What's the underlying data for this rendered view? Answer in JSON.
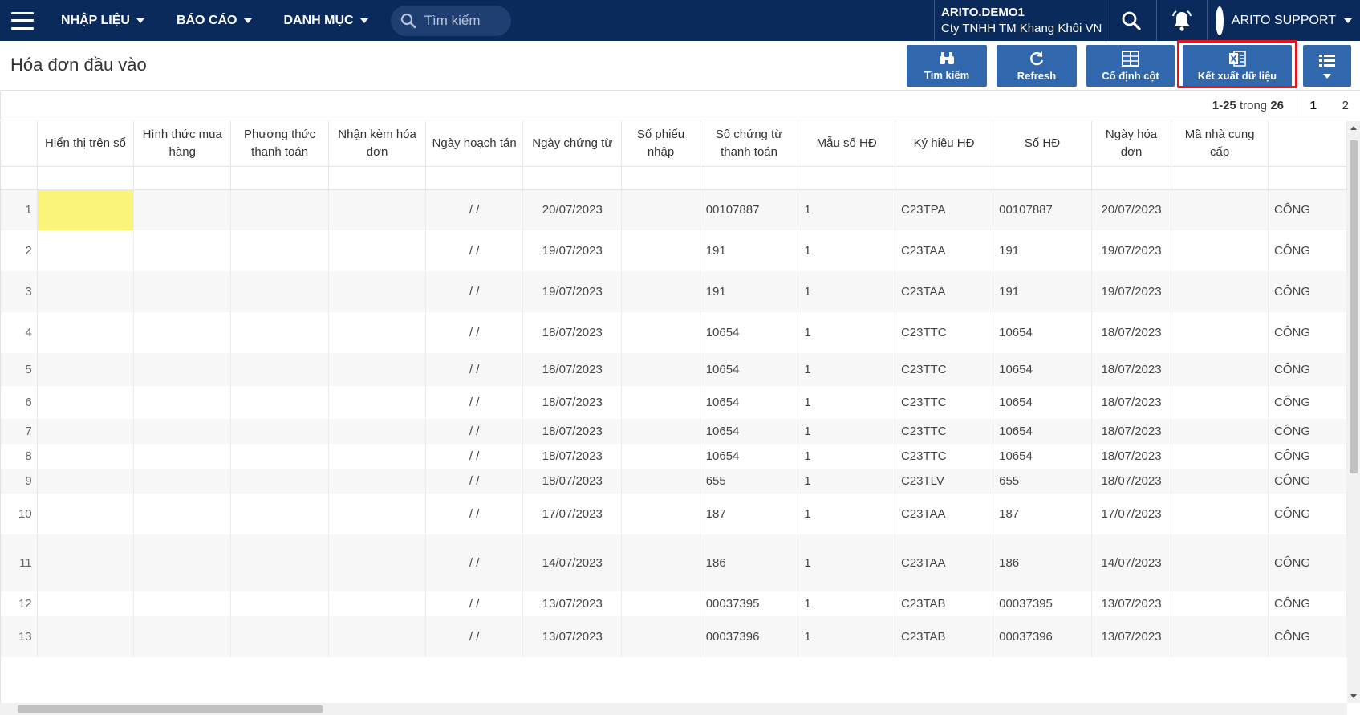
{
  "nav": {
    "menu": [
      {
        "label": "NHẬP LIỆU"
      },
      {
        "label": "BÁO CÁO"
      },
      {
        "label": "DANH MỤC"
      }
    ],
    "search_placeholder": "Tìm kiếm",
    "company_code": "ARITO.DEMO1",
    "company_name": "Cty TNHH TM Khang Khôi VN",
    "user_name": "ARITO SUPPORT"
  },
  "page": {
    "title": "Hóa đơn đầu vào"
  },
  "toolbar": {
    "search_label": "Tìm kiếm",
    "refresh_label": "Refresh",
    "freeze_label": "Cố định cột",
    "export_label": "Kết xuất dữ liệu"
  },
  "pager": {
    "range": "1-25",
    "of_word": "trong",
    "total": "26",
    "pages": [
      "1",
      "2"
    ],
    "current_page": "1"
  },
  "grid": {
    "columns": [
      "Hiển thị trên sổ",
      "Hình thức mua hàng",
      "Phương thức thanh toán",
      "Nhận kèm hóa đơn",
      "Ngày hoạch tán",
      "Ngày chứng từ",
      "Số phiếu nhập",
      "Số chứng từ thanh toán",
      "Mẫu số HĐ",
      "Ký hiệu HĐ",
      "Số HĐ",
      "Ngày hóa đơn",
      "Mã nhà cung cấp",
      ""
    ],
    "rows": [
      {
        "no": "1",
        "hach_toan": "/ /",
        "ngay_ct": "20/07/2023",
        "so_ct_tt": "00107887",
        "mau_so": "1",
        "ky_hieu": "C23TPA",
        "so_hd": "00107887",
        "ngay_hd": "20/07/2023",
        "extra": "CÔNG"
      },
      {
        "no": "2",
        "hach_toan": "/ /",
        "ngay_ct": "19/07/2023",
        "so_ct_tt": "191",
        "mau_so": "1",
        "ky_hieu": "C23TAA",
        "so_hd": "191",
        "ngay_hd": "19/07/2023",
        "extra": "CÔNG"
      },
      {
        "no": "3",
        "hach_toan": "/ /",
        "ngay_ct": "19/07/2023",
        "so_ct_tt": "191",
        "mau_so": "1",
        "ky_hieu": "C23TAA",
        "so_hd": "191",
        "ngay_hd": "19/07/2023",
        "extra": "CÔNG"
      },
      {
        "no": "4",
        "hach_toan": "/ /",
        "ngay_ct": "18/07/2023",
        "so_ct_tt": "10654",
        "mau_so": "1",
        "ky_hieu": "C23TTC",
        "so_hd": "10654",
        "ngay_hd": "18/07/2023",
        "extra": "CÔNG"
      },
      {
        "no": "5",
        "hach_toan": "/ /",
        "ngay_ct": "18/07/2023",
        "so_ct_tt": "10654",
        "mau_so": "1",
        "ky_hieu": "C23TTC",
        "so_hd": "10654",
        "ngay_hd": "18/07/2023",
        "extra": "CÔNG"
      },
      {
        "no": "6",
        "hach_toan": "/ /",
        "ngay_ct": "18/07/2023",
        "so_ct_tt": "10654",
        "mau_so": "1",
        "ky_hieu": "C23TTC",
        "so_hd": "10654",
        "ngay_hd": "18/07/2023",
        "extra": "CÔNG"
      },
      {
        "no": "7",
        "hach_toan": "/ /",
        "ngay_ct": "18/07/2023",
        "so_ct_tt": "10654",
        "mau_so": "1",
        "ky_hieu": "C23TTC",
        "so_hd": "10654",
        "ngay_hd": "18/07/2023",
        "extra": "CÔNG"
      },
      {
        "no": "8",
        "hach_toan": "/ /",
        "ngay_ct": "18/07/2023",
        "so_ct_tt": "10654",
        "mau_so": "1",
        "ky_hieu": "C23TTC",
        "so_hd": "10654",
        "ngay_hd": "18/07/2023",
        "extra": "CÔNG"
      },
      {
        "no": "9",
        "hach_toan": "/ /",
        "ngay_ct": "18/07/2023",
        "so_ct_tt": "655",
        "mau_so": "1",
        "ky_hieu": "C23TLV",
        "so_hd": "655",
        "ngay_hd": "18/07/2023",
        "extra": "CÔNG"
      },
      {
        "no": "10",
        "hach_toan": "/ /",
        "ngay_ct": "17/07/2023",
        "so_ct_tt": "187",
        "mau_so": "1",
        "ky_hieu": "C23TAA",
        "so_hd": "187",
        "ngay_hd": "17/07/2023",
        "extra": "CÔNG"
      },
      {
        "no": "11",
        "hach_toan": "/ /",
        "ngay_ct": "14/07/2023",
        "so_ct_tt": "186",
        "mau_so": "1",
        "ky_hieu": "C23TAA",
        "so_hd": "186",
        "ngay_hd": "14/07/2023",
        "extra": "CÔNG"
      },
      {
        "no": "12",
        "hach_toan": "/ /",
        "ngay_ct": "13/07/2023",
        "so_ct_tt": "00037395",
        "mau_so": "1",
        "ky_hieu": "C23TAB",
        "so_hd": "00037395",
        "ngay_hd": "13/07/2023",
        "extra": "CÔNG"
      },
      {
        "no": "13",
        "hach_toan": "/ /",
        "ngay_ct": "13/07/2023",
        "so_ct_tt": "00037396",
        "mau_so": "1",
        "ky_hieu": "C23TAB",
        "so_hd": "00037396",
        "ngay_hd": "13/07/2023",
        "extra": "CÔNG"
      }
    ]
  },
  "colors": {
    "nav_bg": "#0b2a5c",
    "button_bg": "#3167ad",
    "highlight_border": "#e3141e",
    "selected_cell": "#f8f57a"
  }
}
